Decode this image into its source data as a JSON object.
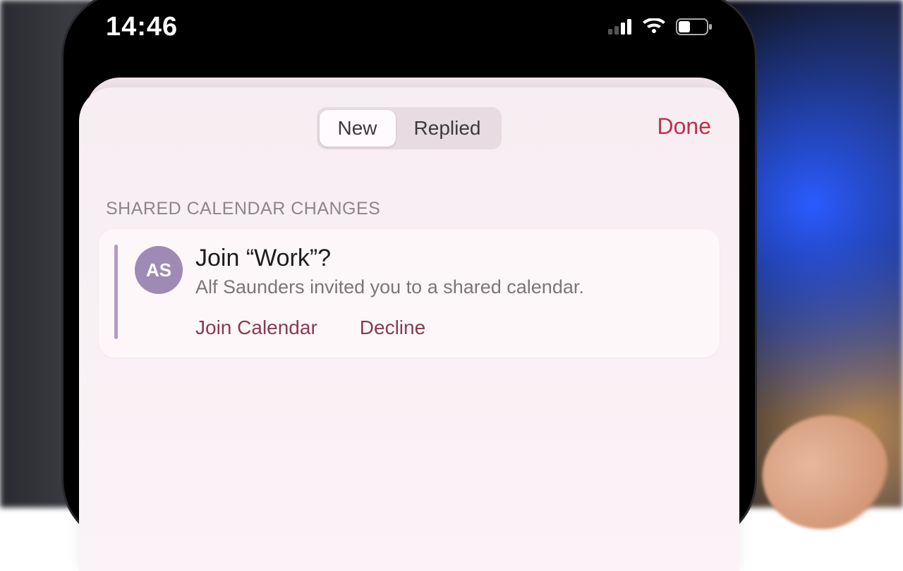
{
  "status": {
    "time": "14:46"
  },
  "header": {
    "tabs": {
      "new": "New",
      "replied": "Replied"
    },
    "done": "Done"
  },
  "section": {
    "title": "SHARED CALENDAR CHANGES"
  },
  "invite": {
    "avatar_initials": "AS",
    "title": "Join “Work”?",
    "subtitle": "Alf Saunders invited you to a shared calendar.",
    "join_label": "Join Calendar",
    "decline_label": "Decline"
  },
  "colors": {
    "accent": "#c1304a"
  }
}
